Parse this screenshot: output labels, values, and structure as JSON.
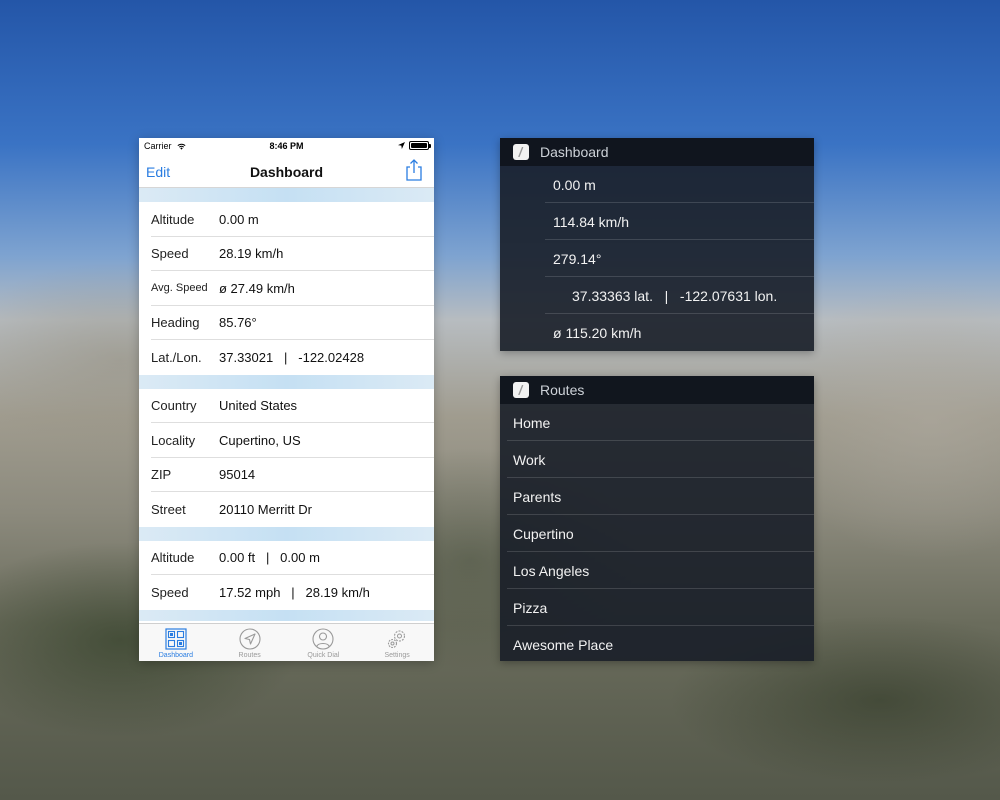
{
  "phone": {
    "status": {
      "carrier": "Carrier",
      "time": "8:46 PM",
      "battery_level": 1.0
    },
    "nav": {
      "edit_label": "Edit",
      "title": "Dashboard",
      "share_icon": "share-icon"
    },
    "section1": [
      {
        "label": "Altitude",
        "value": "0.00 m"
      },
      {
        "label": "Speed",
        "value": "28.19 km/h"
      },
      {
        "label": "Avg. Speed",
        "value": "ø 27.49 km/h"
      },
      {
        "label": "Heading",
        "value": "85.76°"
      },
      {
        "label": "Lat./Lon.",
        "value": "37.33021   |   -122.02428"
      }
    ],
    "section2": [
      {
        "label": "Country",
        "value": "United States"
      },
      {
        "label": "Locality",
        "value": "Cupertino, US"
      },
      {
        "label": "ZIP",
        "value": "95014"
      },
      {
        "label": "Street",
        "value": "20110 Merritt Dr"
      }
    ],
    "section3": [
      {
        "label": "Altitude",
        "value": "0.00 ft   |   0.00 m"
      },
      {
        "label": "Speed",
        "value": "17.52 mph   |   28.19 km/h"
      }
    ],
    "tabs": [
      {
        "label": "Dashboard",
        "icon": "dashboard-grid-icon",
        "active": true
      },
      {
        "label": "Routes",
        "icon": "compass-arrow-icon",
        "active": false
      },
      {
        "label": "Quick Dial",
        "icon": "person-icon",
        "active": false
      },
      {
        "label": "Settings",
        "icon": "gears-icon",
        "active": false
      }
    ],
    "colors": {
      "accent": "#2a7de1",
      "separator": "#c5e0f3"
    }
  },
  "widget_dashboard": {
    "title": "Dashboard",
    "rows": [
      "0.00 m",
      "114.84 km/h",
      "279.14°",
      "37.33363 lat.   |   -122.07631 lon.",
      "ø 115.20 km/h"
    ]
  },
  "widget_routes": {
    "title": "Routes",
    "items": [
      "Home",
      "Work",
      "Parents",
      "Cupertino",
      "Los Angeles",
      "Pizza",
      "Awesome Place"
    ]
  }
}
